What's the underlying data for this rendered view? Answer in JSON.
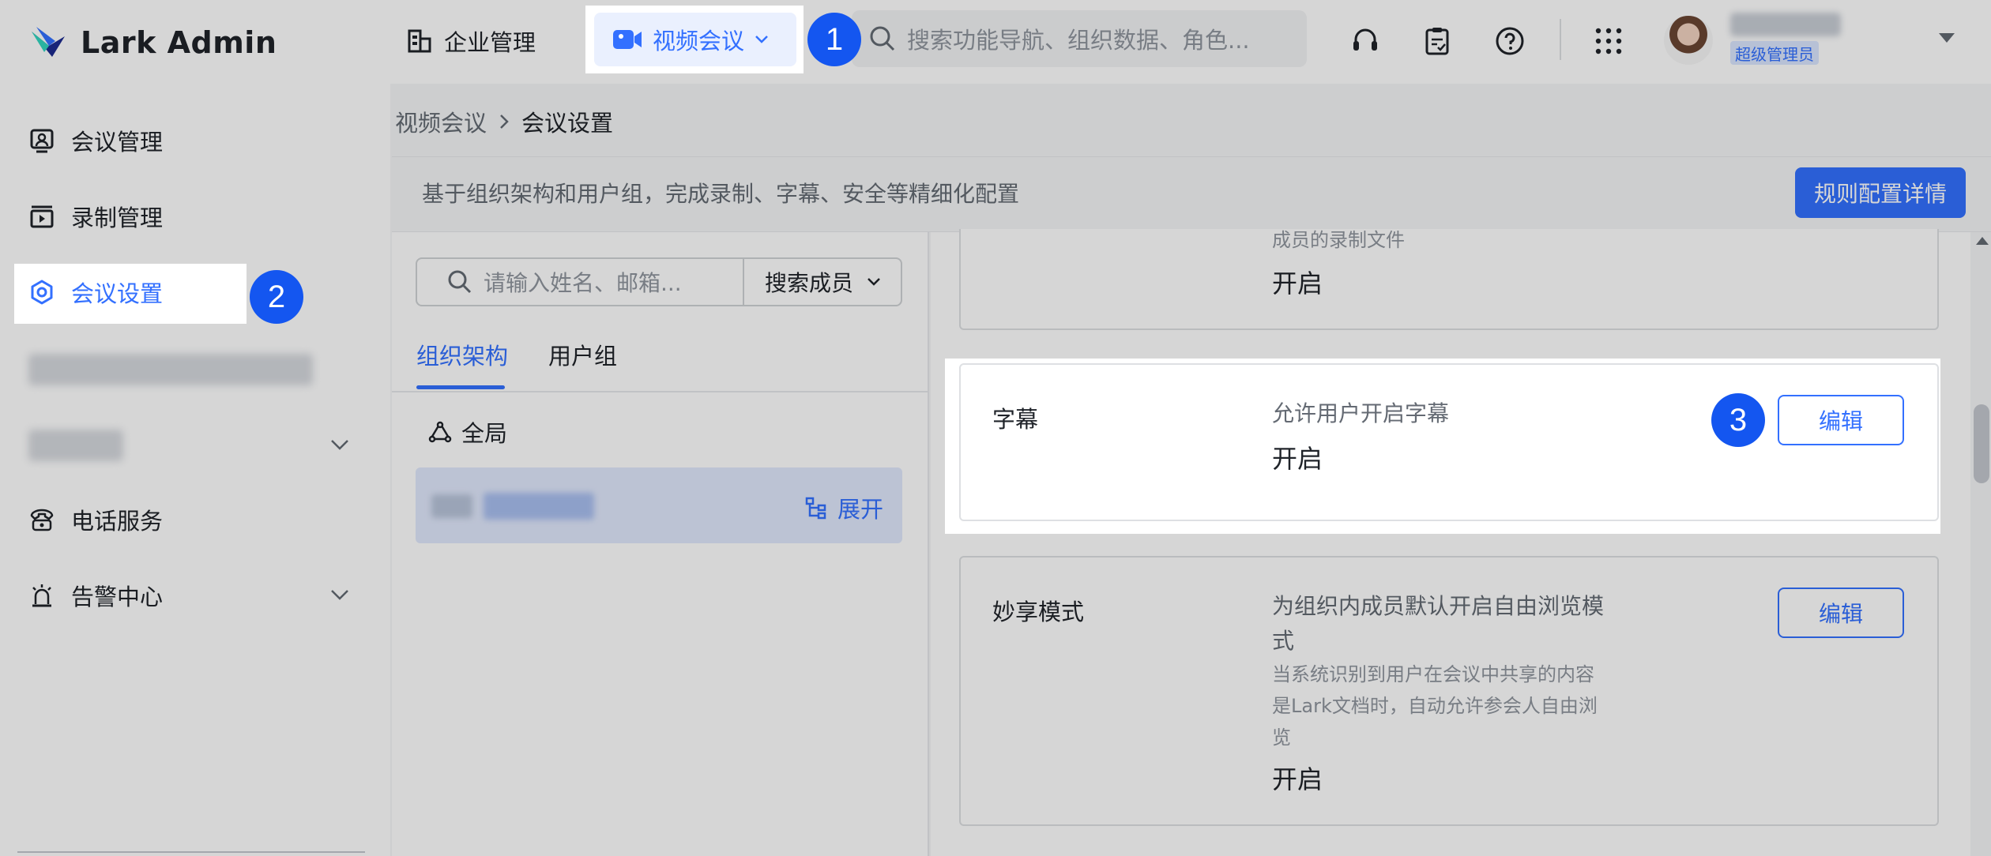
{
  "app": {
    "logo_text": "Lark Admin"
  },
  "topnav": {
    "enterprise": "企业管理",
    "video_meeting": "视频会议",
    "search_placeholder": "搜索功能导航、组织数据、角色..."
  },
  "user": {
    "role": "超级管理员"
  },
  "sidebar": {
    "items": [
      {
        "label": "会议管理"
      },
      {
        "label": "录制管理"
      },
      {
        "label": "会议设置"
      },
      {
        "label": "电话服务"
      },
      {
        "label": "告警中心"
      }
    ]
  },
  "breadcrumb": {
    "parent": "视频会议",
    "current": "会议设置"
  },
  "description": "基于组织架构和用户组，完成录制、字幕、安全等精细化配置",
  "rules_button": "规则配置详情",
  "org_panel": {
    "search_placeholder": "请输入姓名、邮箱...",
    "search_scope": "搜索成员",
    "tabs": [
      "组织架构",
      "用户组"
    ],
    "global": "全局",
    "expand": "展开"
  },
  "settings": [
    {
      "sub": "成员的录制文件",
      "state": "开启"
    },
    {
      "title": "字幕",
      "desc": "允许用户开启字幕",
      "state": "开启",
      "edit": "编辑"
    },
    {
      "title": "妙享模式",
      "desc": "为组织内成员默认开启自由浏览模式",
      "sub": "当系统识别到用户在会议中共享的内容是Lark文档时，自动允许参会人自由浏览",
      "state": "开启",
      "edit": "编辑"
    }
  ],
  "steps": [
    "1",
    "2",
    "3"
  ],
  "colors": {
    "accent": "#3370ff",
    "step_badge": "#1456f0"
  }
}
